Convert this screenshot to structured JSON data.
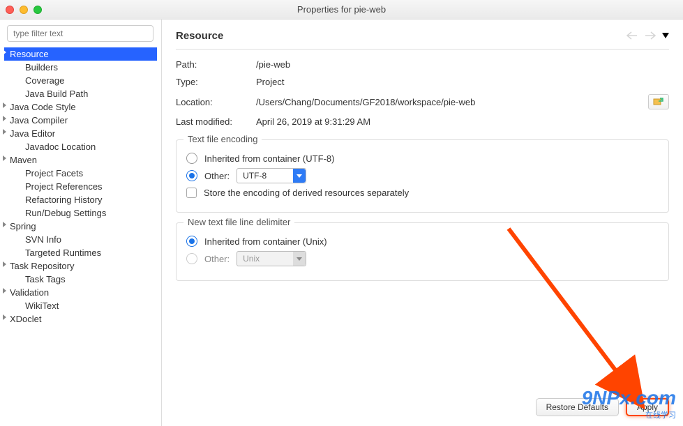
{
  "window": {
    "title": "Properties for pie-web"
  },
  "filter": {
    "placeholder": "type filter text"
  },
  "sidebar": {
    "items": [
      {
        "label": "Resource",
        "expandable": true,
        "selected": true,
        "indent": 0
      },
      {
        "label": "Builders",
        "expandable": false,
        "indent": 1
      },
      {
        "label": "Coverage",
        "expandable": false,
        "indent": 1
      },
      {
        "label": "Java Build Path",
        "expandable": false,
        "indent": 1
      },
      {
        "label": "Java Code Style",
        "expandable": true,
        "indent": 0
      },
      {
        "label": "Java Compiler",
        "expandable": true,
        "indent": 0
      },
      {
        "label": "Java Editor",
        "expandable": true,
        "indent": 0
      },
      {
        "label": "Javadoc Location",
        "expandable": false,
        "indent": 1
      },
      {
        "label": "Maven",
        "expandable": true,
        "indent": 0
      },
      {
        "label": "Project Facets",
        "expandable": false,
        "indent": 1
      },
      {
        "label": "Project References",
        "expandable": false,
        "indent": 1
      },
      {
        "label": "Refactoring History",
        "expandable": false,
        "indent": 1
      },
      {
        "label": "Run/Debug Settings",
        "expandable": false,
        "indent": 1
      },
      {
        "label": "Spring",
        "expandable": true,
        "indent": 0
      },
      {
        "label": "SVN Info",
        "expandable": false,
        "indent": 1
      },
      {
        "label": "Targeted Runtimes",
        "expandable": false,
        "indent": 1
      },
      {
        "label": "Task Repository",
        "expandable": true,
        "indent": 0
      },
      {
        "label": "Task Tags",
        "expandable": false,
        "indent": 1
      },
      {
        "label": "Validation",
        "expandable": true,
        "indent": 0
      },
      {
        "label": "WikiText",
        "expandable": false,
        "indent": 1
      },
      {
        "label": "XDoclet",
        "expandable": true,
        "indent": 0
      }
    ]
  },
  "header": {
    "title": "Resource"
  },
  "info": {
    "path_label": "Path:",
    "path_value": "/pie-web",
    "type_label": "Type:",
    "type_value": "Project",
    "location_label": "Location:",
    "location_value": "/Users/Chang/Documents/GF2018/workspace/pie-web",
    "lastmod_label": "Last modified:",
    "lastmod_value": "April 26, 2019 at 9:31:29 AM"
  },
  "encoding": {
    "group_title": "Text file encoding",
    "inherited_label": "Inherited from container (UTF-8)",
    "other_label": "Other:",
    "other_value": "UTF-8",
    "store_derived_label": "Store the encoding of derived resources separately"
  },
  "delimiter": {
    "group_title": "New text file line delimiter",
    "inherited_label": "Inherited from container (Unix)",
    "other_label": "Other:",
    "other_value": "Unix"
  },
  "buttons": {
    "restore": "Restore Defaults",
    "apply": "Apply"
  },
  "watermark": {
    "brand": "9NPx.com",
    "tag": "在线学习"
  }
}
